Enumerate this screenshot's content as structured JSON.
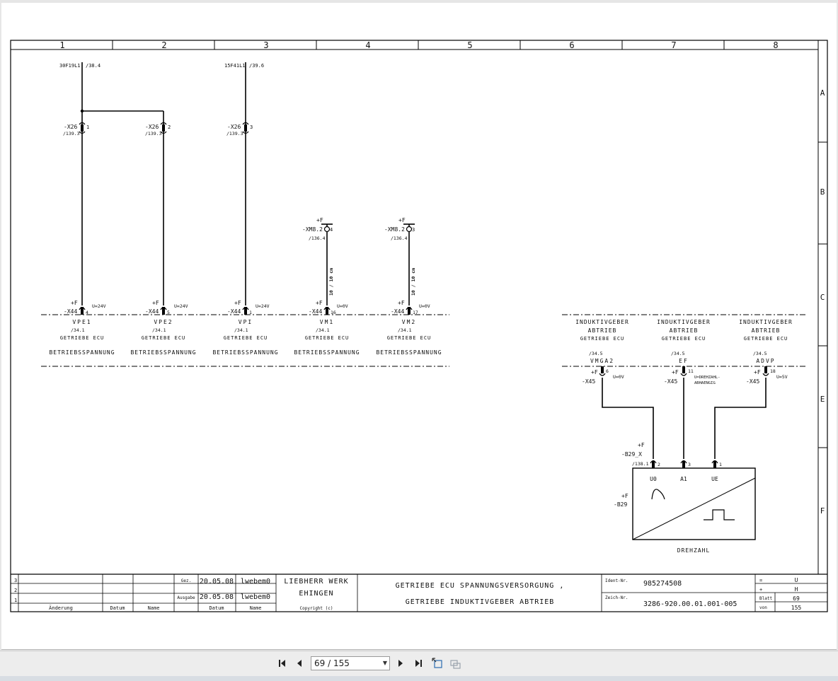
{
  "columns": [
    "1",
    "2",
    "3",
    "4",
    "5",
    "6",
    "7",
    "8"
  ],
  "rows": [
    "A",
    "B",
    "C",
    "E",
    "F"
  ],
  "sources": [
    {
      "wire": "30F19L1",
      "ref": "/38.4"
    },
    {
      "wire": "15F41L1",
      "ref": "/39.6"
    }
  ],
  "x26": [
    {
      "tag": "-X26",
      "pin": "1",
      "ref": "/139.3"
    },
    {
      "tag": "-X26",
      "pin": "2",
      "ref": "/139.3"
    },
    {
      "tag": "-X26",
      "pin": "3",
      "ref": "/139.3"
    }
  ],
  "xm8": [
    {
      "loc": "+F",
      "tag": "-XM8.2",
      "pin": "4",
      "ref": "/136.4",
      "cable": "10 / 10 cm"
    },
    {
      "loc": "+F",
      "tag": "-XM8.2",
      "pin": "3",
      "ref": "/136.4",
      "cable": "10 / 10 cm"
    }
  ],
  "ecu_pins": [
    {
      "loc": "+F",
      "tag": "-X44",
      "pin": "4",
      "voltage": "U=24V",
      "signal": "VPE1",
      "ref": "/34.1",
      "device": "GETRIEBE ECU",
      "func": "BETRIEBSSPANNUNG"
    },
    {
      "loc": "+F",
      "tag": "-X44",
      "pin": "5",
      "voltage": "U=24V",
      "signal": "VPE2",
      "ref": "/34.1",
      "device": "GETRIEBE ECU",
      "func": "BETRIEBSSPANNUNG"
    },
    {
      "loc": "+F",
      "tag": "-X44",
      "pin": "1",
      "voltage": "U=24V",
      "signal": "VPI",
      "ref": "/34.1",
      "device": "GETRIEBE ECU",
      "func": "BETRIEBSSPANNUNG"
    },
    {
      "loc": "+F",
      "tag": "-X44",
      "pin": "16",
      "voltage": "U=0V",
      "signal": "VM1",
      "ref": "/34.1",
      "device": "GETRIEBE ECU",
      "func": "BETRIEBSSPANNUNG"
    },
    {
      "loc": "+F",
      "tag": "-X44",
      "pin": "17",
      "voltage": "U=0V",
      "signal": "VM2",
      "ref": "/34.1",
      "device": "GETRIEBE ECU",
      "func": "BETRIEBSSPANNUNG"
    }
  ],
  "sensor_inputs": [
    {
      "title1": "INDUKTIVGEBER",
      "title2": "ABTRIEB",
      "device": "GETRIEBE ECU",
      "ref": "/34.5",
      "signal": "VMGA2",
      "loc": "+F",
      "tag": "-X45",
      "pin": "6",
      "voltage": "U=0V",
      "voltage2": ""
    },
    {
      "title1": "INDUKTIVGEBER",
      "title2": "ABTRIEB",
      "device": "GETRIEBE ECU",
      "ref": "/34.5",
      "signal": "EF",
      "loc": "+F",
      "tag": "-X45",
      "pin": "11",
      "voltage": "U=DREHZAHL-",
      "voltage2": "ABHAENGIG"
    },
    {
      "title1": "INDUKTIVGEBER",
      "title2": "ABTRIEB",
      "device": "GETRIEBE ECU",
      "ref": "/34.5",
      "signal": "ADVP",
      "loc": "+F",
      "tag": "-X45",
      "pin": "18",
      "voltage": "U=5V",
      "voltage2": ""
    }
  ],
  "sensor": {
    "conn_loc": "+F",
    "conn_tag": "-B29_X",
    "conn_ref": "/138.1",
    "pins": [
      "2",
      "3",
      "1"
    ],
    "labels": [
      "U0",
      "A1",
      "UE"
    ],
    "loc": "+F",
    "tag": "-B29",
    "name": "DREHZAHL"
  },
  "titleblock": {
    "rev_rows": [
      "3",
      "2",
      "1"
    ],
    "rev_headers": [
      "Änderung",
      "Datum",
      "Name"
    ],
    "gez_label": "Gez.",
    "gez_date": "20.05.08",
    "gez_name": "lwebem0",
    "ausgabe_label": "Ausgabe",
    "ausgabe_date": "20.05.08",
    "ausgabe_name": "lwebem0",
    "col_datum": "Datum",
    "col_name": "Name",
    "company1": "LIEBHERR WERK",
    "company2": "EHINGEN",
    "copyright": "Copyright (c)",
    "title1": "GETRIEBE ECU SPANNUNGSVERSORGUNG ,",
    "title2": "GETRIEBE INDUKTIVGEBER ABTRIEB",
    "ident_label": "Ident-Nr.",
    "ident": "985274508",
    "zeich_label": "Zeich-Nr.",
    "zeich": "3286-920.00.01.001-005",
    "eq_label": "=",
    "eq_value": "U",
    "plus_label": "+",
    "plus_value": "H",
    "blatt_label": "Blatt",
    "blatt": "69",
    "von_label": "von",
    "von": "155"
  },
  "nav": {
    "page_value": "69 / 155",
    "first_icon": "first-page-icon",
    "prev_icon": "prev-page-icon",
    "next_icon": "next-page-icon",
    "last_icon": "last-page-icon"
  }
}
